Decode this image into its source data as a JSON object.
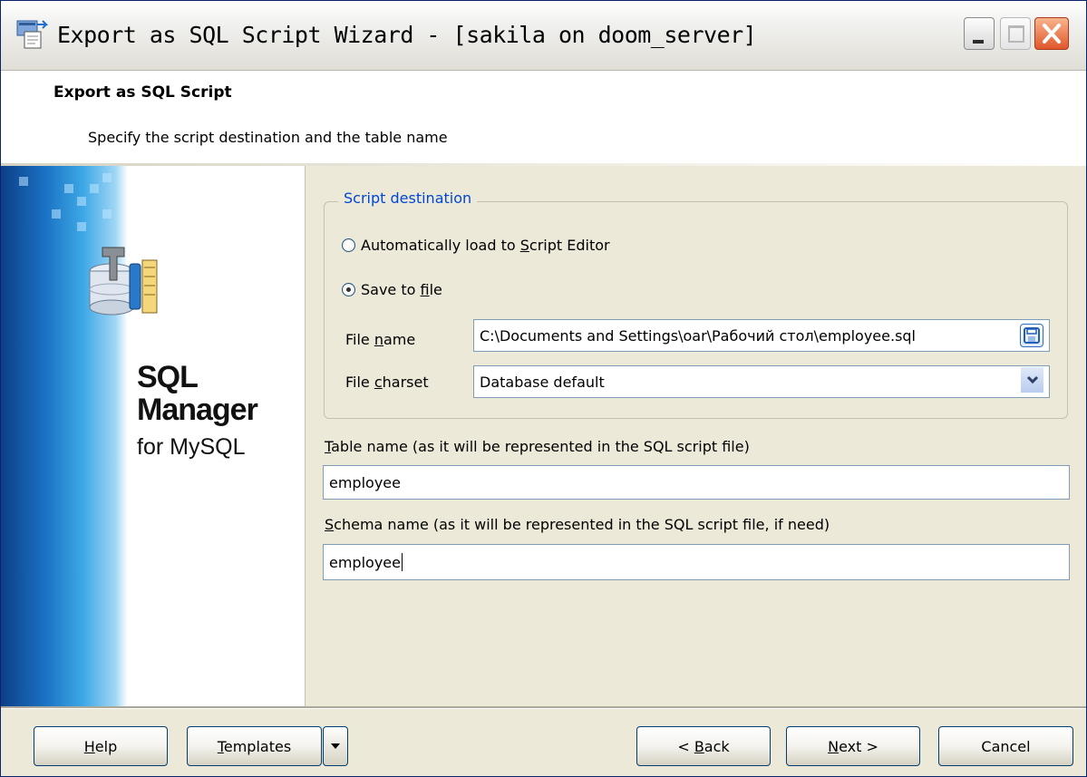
{
  "window": {
    "title": "Export as SQL Script Wizard - [sakila on doom_server]"
  },
  "header": {
    "title": "Export as SQL Script",
    "subtitle": "Specify the script destination and the table name"
  },
  "banner": {
    "brand_line1": "SQL",
    "brand_line2": "Manager",
    "brand_line3": "for MySQL"
  },
  "script_destination": {
    "legend": "Script destination",
    "option_auto": {
      "pre": "Automatically load to ",
      "key": "S",
      "post": "cript Editor",
      "selected": false
    },
    "option_file": {
      "pre": "Save to ",
      "key": "f",
      "post": "ile",
      "selected": true
    }
  },
  "file_name": {
    "label_pre": "File ",
    "label_key": "n",
    "label_post": "ame",
    "value": "C:\\Documents and Settings\\oar\\Рабочий стол\\employee.sql"
  },
  "file_charset": {
    "label_pre": "File ",
    "label_key": "c",
    "label_post": "harset",
    "value": "Database default"
  },
  "table_name": {
    "label_key": "T",
    "label_post": "able name (as it will be represented in the SQL script file)",
    "value": "employee"
  },
  "schema_name": {
    "label_key": "S",
    "label_post": "chema name (as it will be represented in the SQL script file, if need)",
    "value": "employee"
  },
  "buttons": {
    "help_key": "H",
    "help_post": "elp",
    "templates_key": "T",
    "templates_post": "emplates",
    "back_pre": "< ",
    "back_key": "B",
    "back_post": "ack",
    "next_key": "N",
    "next_post": "ext >",
    "cancel": "Cancel"
  },
  "colors": {
    "legend": "#0046d5",
    "window_bg": "#ece9d8",
    "border_blue": "#003c74"
  }
}
